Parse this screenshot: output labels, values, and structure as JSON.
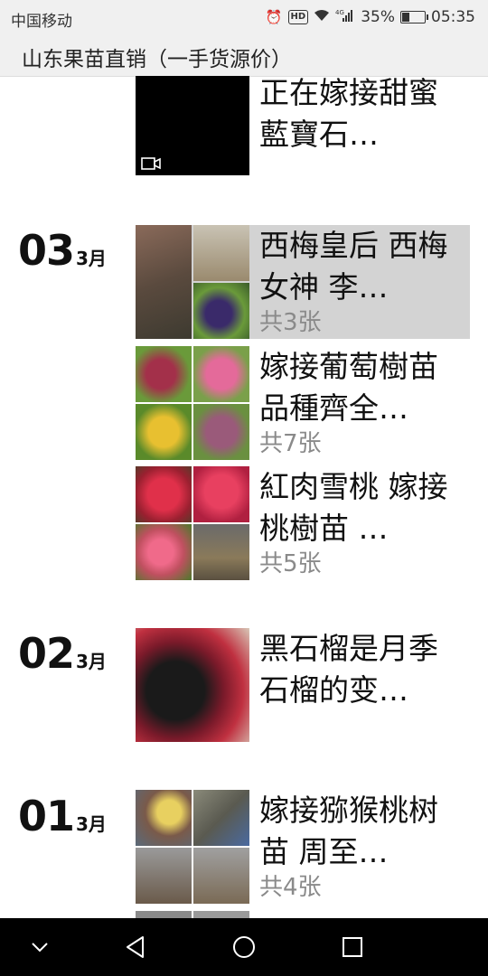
{
  "status_bar": {
    "carrier": "中国移动",
    "network": "4G",
    "hd": "HD",
    "battery_percent_text": "35%",
    "battery_level": 0.35,
    "time": "05:35"
  },
  "app": {
    "title": "山东果苗直销（一手货源价）"
  },
  "posts": [
    {
      "title": "正在嫁接甜蜜藍寶石…"
    },
    {
      "title": "西梅皇后  西梅女神  李…",
      "count": "共3张"
    },
    {
      "title": "嫁接葡萄樹苗 品種齊全…",
      "count": "共7张"
    },
    {
      "title": "紅肉雪桃  嫁接桃樹苗  …",
      "count": "共5张"
    },
    {
      "title": "黑石榴是月季石榴的变…"
    },
    {
      "title": "嫁接猕猴桃树苗  周至…",
      "count": "共4张"
    }
  ],
  "dates": [
    {
      "day": "03",
      "month": "3月"
    },
    {
      "day": "02",
      "month": "3月"
    },
    {
      "day": "01",
      "month": "3月"
    }
  ],
  "nav": {
    "back": "back-icon",
    "home": "home-icon",
    "recents": "recents-icon",
    "collapse": "chevron-down-icon"
  }
}
